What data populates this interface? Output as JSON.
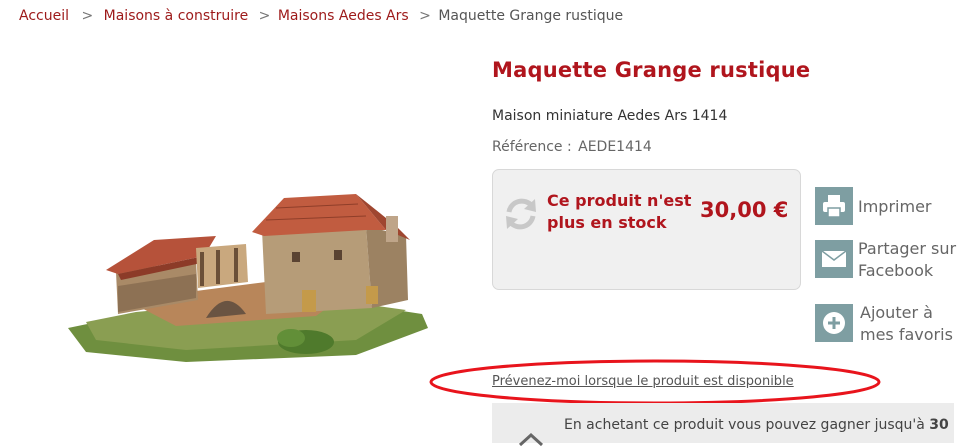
{
  "breadcrumb": {
    "home": "Accueil",
    "cat1": "Maisons à construire",
    "cat2": "Maisons Aedes Ars",
    "current": "Maquette Grange rustique"
  },
  "product": {
    "title": "Maquette Grange rustique",
    "subtitle": "Maison miniature Aedes Ars 1414",
    "reference_label": "Référence :",
    "reference_value": "AEDE1414",
    "stock_line1": "Ce produit n'est",
    "stock_line2": "plus en stock",
    "price": "30,00 €"
  },
  "actions": {
    "print": "Imprimer",
    "share_line1": "Partager sur",
    "share_line2": "Facebook",
    "fav_line1": "Ajouter à",
    "fav_line2": "mes favoris"
  },
  "notify": {
    "link": "Prévenez-moi lorsque le produit est disponible"
  },
  "loyalty": {
    "text_start": "En achetant ce produit vous pouvez gagner jusqu'à ",
    "text_bold": "30"
  },
  "colors": {
    "accent": "#b0151d",
    "link": "#9d1a1a",
    "icon_bg": "#7e9ea2",
    "annotation": "#e8141c"
  }
}
